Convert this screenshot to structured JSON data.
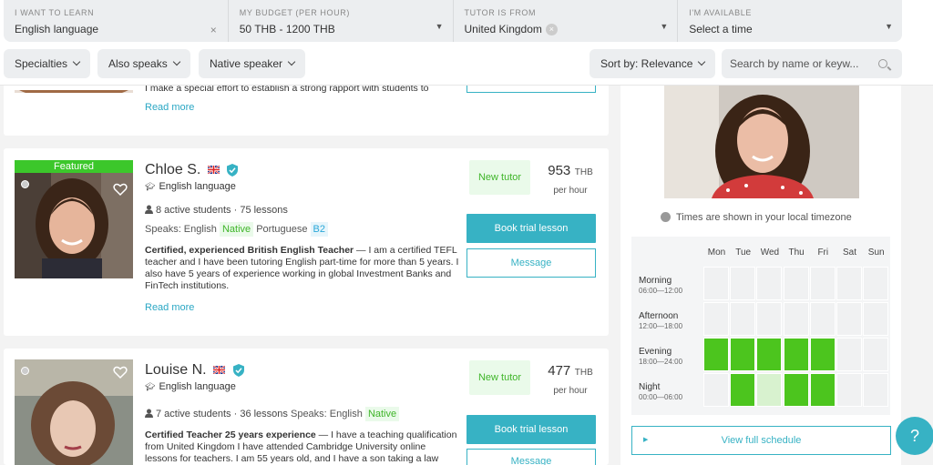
{
  "filters": [
    {
      "label": "I WANT TO LEARN",
      "value": "English language"
    },
    {
      "label": "MY BUDGET (PER HOUR)",
      "value": "50 THB - 1200 THB"
    },
    {
      "label": "TUTOR IS FROM",
      "value": "United Kingdom"
    },
    {
      "label": "I'M AVAILABLE",
      "value": "Select a time"
    }
  ],
  "clear_symbol": "×",
  "pills": {
    "specialties": "Specialties",
    "also_speaks": "Also speaks",
    "native_speaker": "Native speaker",
    "sort": "Sort by: Relevance"
  },
  "search": {
    "placeholder": "Search by name or keyw..."
  },
  "prev_card": {
    "desc": "I make a special effort to establish a strong rapport with students to",
    "read_more": "Read more"
  },
  "tutors": [
    {
      "featured": "Featured",
      "name": "Chloe S.",
      "subject": "English language",
      "stats": "8 active students · 75 lessons",
      "speaks_label": "Speaks: English",
      "lang1_level": "Native",
      "lang2": "Portuguese",
      "lang2_level": "B2",
      "desc_bold": "Certified, experienced British English Teacher",
      "desc": " — I am a certified TEFL teacher and I have been tutoring English part-time for more than 5 years. I also have 5 years of experience working in global Investment Banks and FinTech institutions.",
      "read_more": "Read more",
      "new_tutor": "New tutor",
      "price": "953",
      "currency": "THB",
      "per_hour": "per hour",
      "book": "Book trial lesson",
      "message": "Message"
    },
    {
      "name": "Louise N.",
      "subject": "English language",
      "stats": "7 active students · 36 lessons",
      "speaks_label": "Speaks: English",
      "lang1_level": "Native",
      "desc_bold": "Certified Teacher 25 years experience",
      "desc": " — I have a teaching qualification from United Kingdom I have attended Cambridge University online lessons for teachers. I am 55 years old, and I have a son taking a law",
      "new_tutor": "New tutor",
      "price": "477",
      "currency": "THB",
      "per_hour": "per hour",
      "book": "Book trial lesson",
      "message": "Message"
    }
  ],
  "schedule": {
    "timezone_note": "Times are shown in your local timezone",
    "days": [
      "Mon",
      "Tue",
      "Wed",
      "Thu",
      "Fri",
      "Sat",
      "Sun"
    ],
    "rows": [
      {
        "label": "Morning",
        "range": "06:00—12:00",
        "avail": [
          0,
          0,
          0,
          0,
          0,
          0,
          0
        ]
      },
      {
        "label": "Afternoon",
        "range": "12:00—18:00",
        "avail": [
          0,
          0,
          0,
          0,
          0,
          0,
          0
        ]
      },
      {
        "label": "Evening",
        "range": "18:00—24:00",
        "avail": [
          1,
          1,
          1,
          1,
          1,
          0,
          0
        ]
      },
      {
        "label": "Night",
        "range": "00:00—06:00",
        "avail": [
          0,
          1,
          0.5,
          1,
          1,
          0,
          0
        ]
      }
    ],
    "view_full": "View full schedule"
  },
  "help": "?",
  "colors": {
    "accent": "#37b2c4",
    "available": "#4cc51e",
    "featured": "#3cc72b"
  }
}
